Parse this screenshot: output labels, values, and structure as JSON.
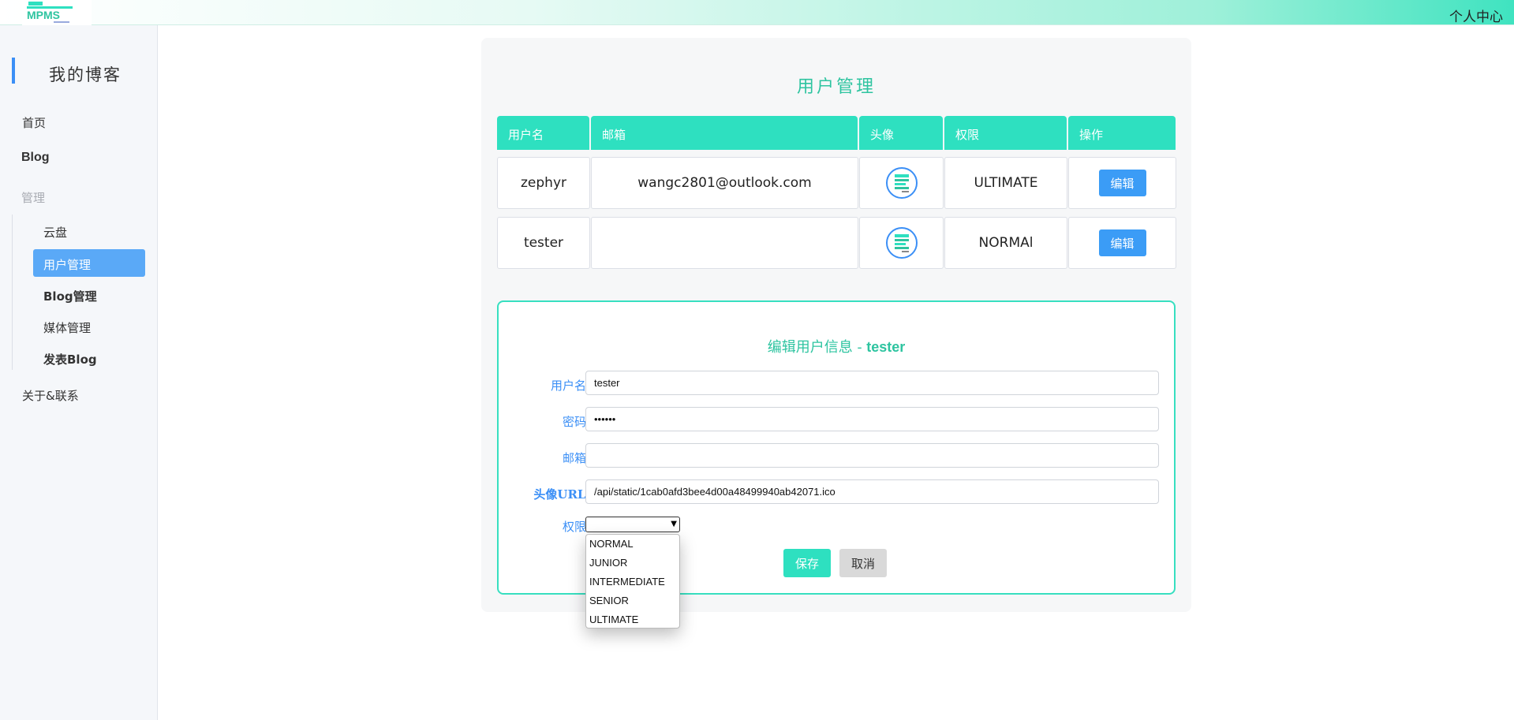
{
  "header": {
    "logo_icon": "mpms-logo",
    "personal_center": "个人中心"
  },
  "sidebar": {
    "title": "我的博客",
    "home": "首页",
    "blog": "Blog",
    "manage": "管理",
    "cloud": "云盘",
    "user_mgmt": "用户管理",
    "blog_mgmt": "Blog管理",
    "media_mgmt": "媒体管理",
    "post_blog": "发表Blog",
    "about": "关于&联系"
  },
  "main": {
    "title": "用户管理",
    "columns": [
      "用户名",
      "邮箱",
      "头像",
      "权限",
      "操作"
    ],
    "rows": [
      {
        "username": "zephyr",
        "email": "wangc2801@outlook.com",
        "avatar_icon": "avatar-icon",
        "role": "ULTIMATE",
        "action": "编辑"
      },
      {
        "username": "tester",
        "email": "",
        "avatar_icon": "avatar-icon",
        "role": "NORMAl",
        "action": "编辑"
      }
    ]
  },
  "form": {
    "title_prefix": "编辑用户信息 - ",
    "title_user": "tester",
    "username_label": "用户名:",
    "username_value": "tester",
    "password_label": "密码:",
    "password_value": "••••••",
    "email_label": "邮箱:",
    "email_value": "",
    "avatar_label": "头像URL:",
    "avatar_value": "/api/static/1cab0afd3bee4d00a48499940ab42071.ico",
    "role_label": "权限:",
    "role_selected": "",
    "role_options": [
      "NORMAL",
      "JUNIOR",
      "INTERMEDIATE",
      "SENIOR",
      "ULTIMATE"
    ],
    "save": "保存",
    "cancel": "取消"
  },
  "colors": {
    "accent": "#2ee0c0",
    "primary": "#3b8ff6",
    "active_nav": "#5aa9f7"
  }
}
